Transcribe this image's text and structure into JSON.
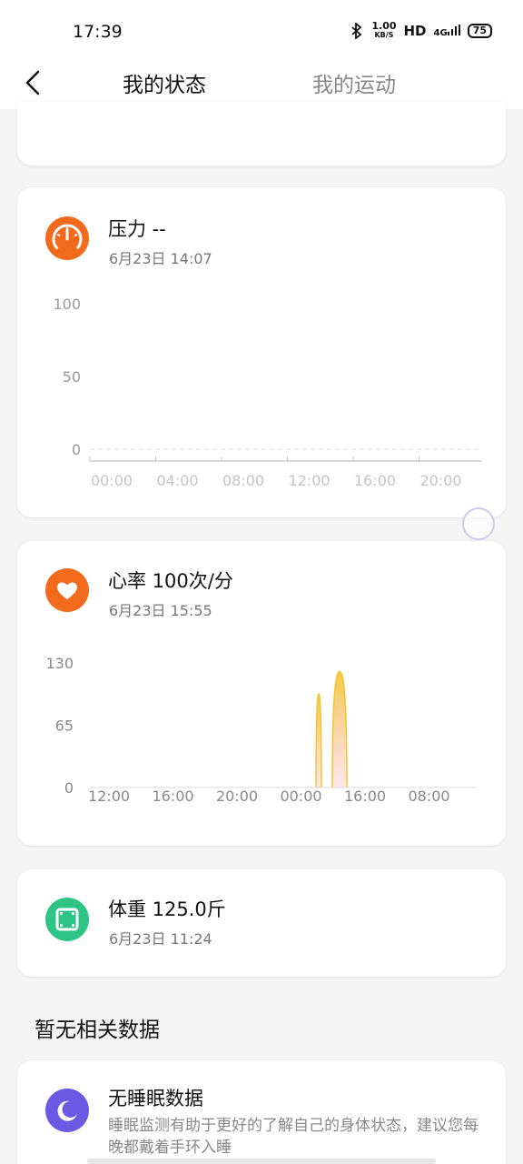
{
  "status_bar": {
    "time": "17:39",
    "speed_value": "1.00",
    "speed_unit": "KB/S",
    "hd": "HD",
    "network": "4G",
    "battery": "75"
  },
  "nav": {
    "tabs": [
      "我的状态",
      "我的运动"
    ],
    "active_tab": 0
  },
  "pressure": {
    "title": "压力 --",
    "time": "6月23日 14:07",
    "icon": "gauge-icon",
    "color": "#f26b1d"
  },
  "heart": {
    "title": "心率 100次/分",
    "time": "6月23日 15:55",
    "icon": "heart-icon",
    "color": "#f26b1d"
  },
  "weight": {
    "title": "体重 125.0斤",
    "time": "6月23日 11:24",
    "icon": "scale-icon",
    "color": "#2ec486"
  },
  "no_data": {
    "section_title": "暂无相关数据"
  },
  "sleep": {
    "title": "无睡眠数据",
    "description": "睡眠监测有助于更好的了解自己的身体状态，建议您每晚都戴着手环入睡",
    "icon": "moon-icon",
    "color": "#6b58e3"
  },
  "chart_data": [
    {
      "type": "line",
      "categories": [
        "00:00",
        "04:00",
        "08:00",
        "12:00",
        "16:00",
        "20:00"
      ],
      "y_ticks": [
        "100",
        "50",
        "0"
      ],
      "ylim": [
        0,
        100
      ],
      "series": []
    },
    {
      "type": "area",
      "categories": [
        "12:00",
        "16:00",
        "20:00",
        "00:00",
        "16:00",
        "08:00"
      ],
      "y_ticks": [
        "130",
        "65",
        "0"
      ],
      "ylim": [
        0,
        130
      ],
      "spikes": [
        {
          "between": "00:00-16:00",
          "value": 98
        },
        {
          "between": "00:00-16:00",
          "value": 121
        }
      ],
      "color": "#f5c52a"
    }
  ]
}
